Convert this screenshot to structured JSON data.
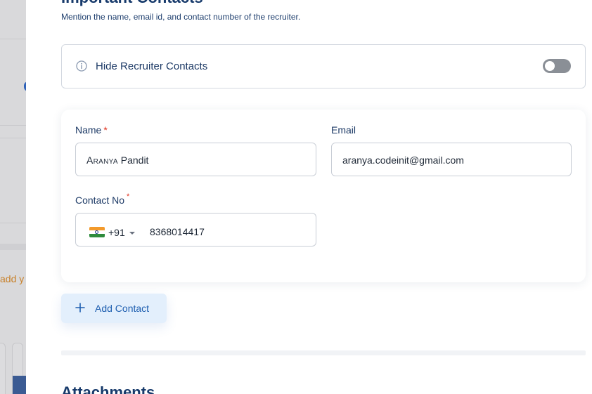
{
  "background": {
    "partial_text": "add y"
  },
  "section": {
    "title": "Important Contacts",
    "subtitle": "Mention the name, email id, and contact number of the recruiter."
  },
  "hide_contacts": {
    "label": "Hide Recruiter Contacts",
    "icon": "info-icon",
    "enabled": false
  },
  "form": {
    "name": {
      "label": "Name",
      "required_mark": "*",
      "first": "Aranya",
      "last": " Pandit"
    },
    "email": {
      "label": "Email",
      "value": "aranya.codeinit@gmail.com"
    },
    "contact": {
      "label": "Contact No",
      "required_mark": "*",
      "country_flag": "india-flag-icon",
      "dial_code": "+91",
      "number": "8368014417"
    }
  },
  "add_contact": {
    "label": "Add Contact",
    "icon": "plus-icon"
  },
  "attachments": {
    "title": "Attachments"
  },
  "colors": {
    "heading": "#173a6b",
    "accent": "#1f5fb0",
    "required": "#e0321f",
    "toggle_off": "#8a8f96",
    "button_bg": "#e3effc"
  }
}
